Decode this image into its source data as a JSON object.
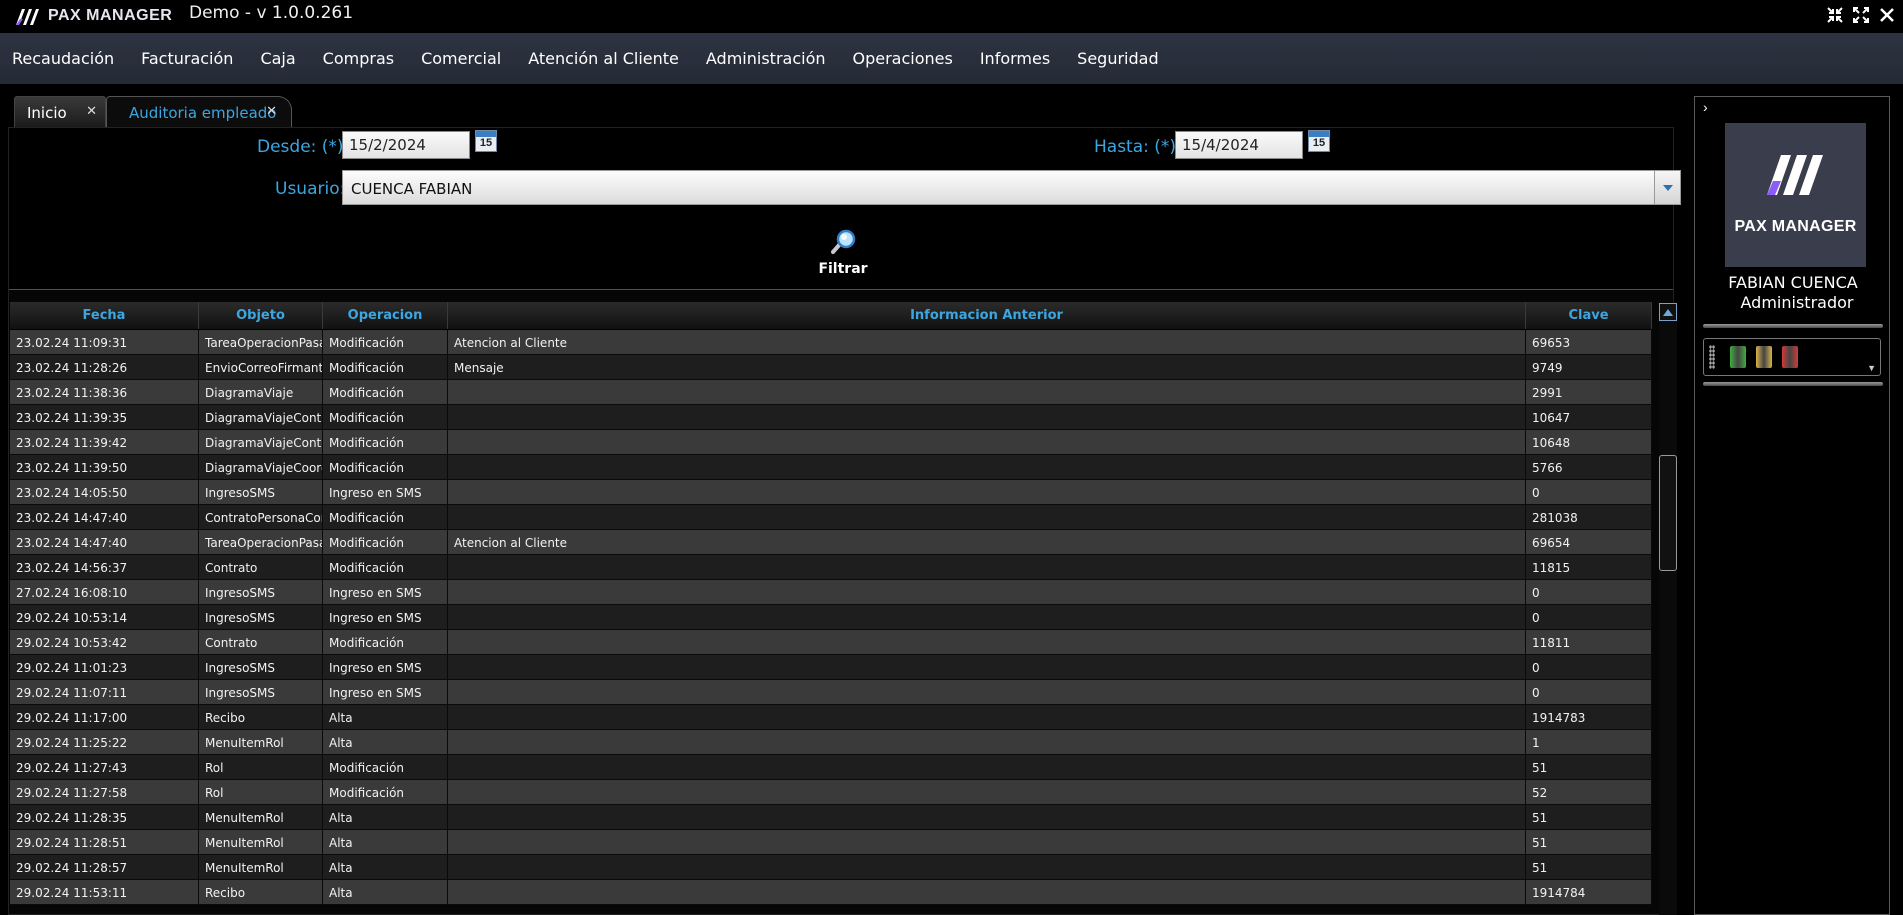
{
  "app": {
    "logo_text": "PAX MANAGER",
    "title": "Demo - v 1.0.0.261"
  },
  "window_controls": [
    "collapse",
    "expand",
    "close"
  ],
  "menu": [
    "Recaudación",
    "Facturación",
    "Caja",
    "Compras",
    "Comercial",
    "Atención al Cliente",
    "Administración",
    "Operaciones",
    "Informes",
    "Seguridad"
  ],
  "tabs": [
    {
      "label": "Inicio",
      "active": false
    },
    {
      "label": "Auditoria empleado",
      "active": true
    }
  ],
  "filters": {
    "desde_label": "Desde: (*)",
    "desde_value": "15/2/2024",
    "hasta_label": "Hasta: (*)",
    "hasta_value": "15/4/2024",
    "calendar_day": "15",
    "usuario_label": "Usuario:",
    "usuario_value": "CUENCA FABIAN",
    "filtrar_label": "Filtrar"
  },
  "grid": {
    "columns": [
      "Fecha",
      "Objeto",
      "Operacion",
      "Informacion Anterior",
      "Clave"
    ],
    "rows": [
      [
        "23.02.24 11:09:31",
        "TareaOperacionPasa",
        "Modificación",
        "Atencion al Cliente",
        "69653"
      ],
      [
        "23.02.24 11:28:26",
        "EnvioCorreoFirmant",
        "Modificación",
        "Mensaje",
        "9749"
      ],
      [
        "23.02.24 11:38:36",
        "DiagramaViaje",
        "Modificación",
        "",
        "2991"
      ],
      [
        "23.02.24 11:39:35",
        "DiagramaViajeContr",
        "Modificación",
        "",
        "10647"
      ],
      [
        "23.02.24 11:39:42",
        "DiagramaViajeContr",
        "Modificación",
        "",
        "10648"
      ],
      [
        "23.02.24 11:39:50",
        "DiagramaViajeCoord",
        "Modificación",
        "",
        "5766"
      ],
      [
        "23.02.24 14:05:50",
        "IngresoSMS",
        "Ingreso en SMS",
        "",
        "0"
      ],
      [
        "23.02.24 14:47:40",
        "ContratoPersonaCor",
        "Modificación",
        "",
        "281038"
      ],
      [
        "23.02.24 14:47:40",
        "TareaOperacionPasa",
        "Modificación",
        "Atencion al Cliente",
        "69654"
      ],
      [
        "23.02.24 14:56:37",
        "Contrato",
        "Modificación",
        "",
        "11815"
      ],
      [
        "27.02.24 16:08:10",
        "IngresoSMS",
        "Ingreso en SMS",
        "",
        "0"
      ],
      [
        "29.02.24 10:53:14",
        "IngresoSMS",
        "Ingreso en SMS",
        "",
        "0"
      ],
      [
        "29.02.24 10:53:42",
        "Contrato",
        "Modificación",
        "",
        "11811"
      ],
      [
        "29.02.24 11:01:23",
        "IngresoSMS",
        "Ingreso en SMS",
        "",
        "0"
      ],
      [
        "29.02.24 11:07:11",
        "IngresoSMS",
        "Ingreso en SMS",
        "",
        "0"
      ],
      [
        "29.02.24 11:17:00",
        "Recibo",
        "Alta",
        "",
        "1914783"
      ],
      [
        "29.02.24 11:25:22",
        "MenuItemRol",
        "Alta",
        "",
        "1"
      ],
      [
        "29.02.24 11:27:43",
        "Rol",
        "Modificación",
        "",
        "51"
      ],
      [
        "29.02.24 11:27:58",
        "Rol",
        "Modificación",
        "",
        "52"
      ],
      [
        "29.02.24 11:28:35",
        "MenuItemRol",
        "Alta",
        "",
        "51"
      ],
      [
        "29.02.24 11:28:51",
        "MenuItemRol",
        "Alta",
        "",
        "51"
      ],
      [
        "29.02.24 11:28:57",
        "MenuItemRol",
        "Alta",
        "",
        "51"
      ],
      [
        "29.02.24 11:53:11",
        "Recibo",
        "Alta",
        "",
        "1914784"
      ]
    ]
  },
  "user_panel": {
    "logo_text": "PAX MANAGER",
    "name": "FABIAN CUENCA",
    "role": "Administrador",
    "tool_colors": [
      "#3fae3f",
      "#d8b24a",
      "#d23a3a"
    ]
  },
  "colors": {
    "accent": "#3ca6e0",
    "brand_purple": "#8b5cf6",
    "menubar": "#2a303c"
  }
}
